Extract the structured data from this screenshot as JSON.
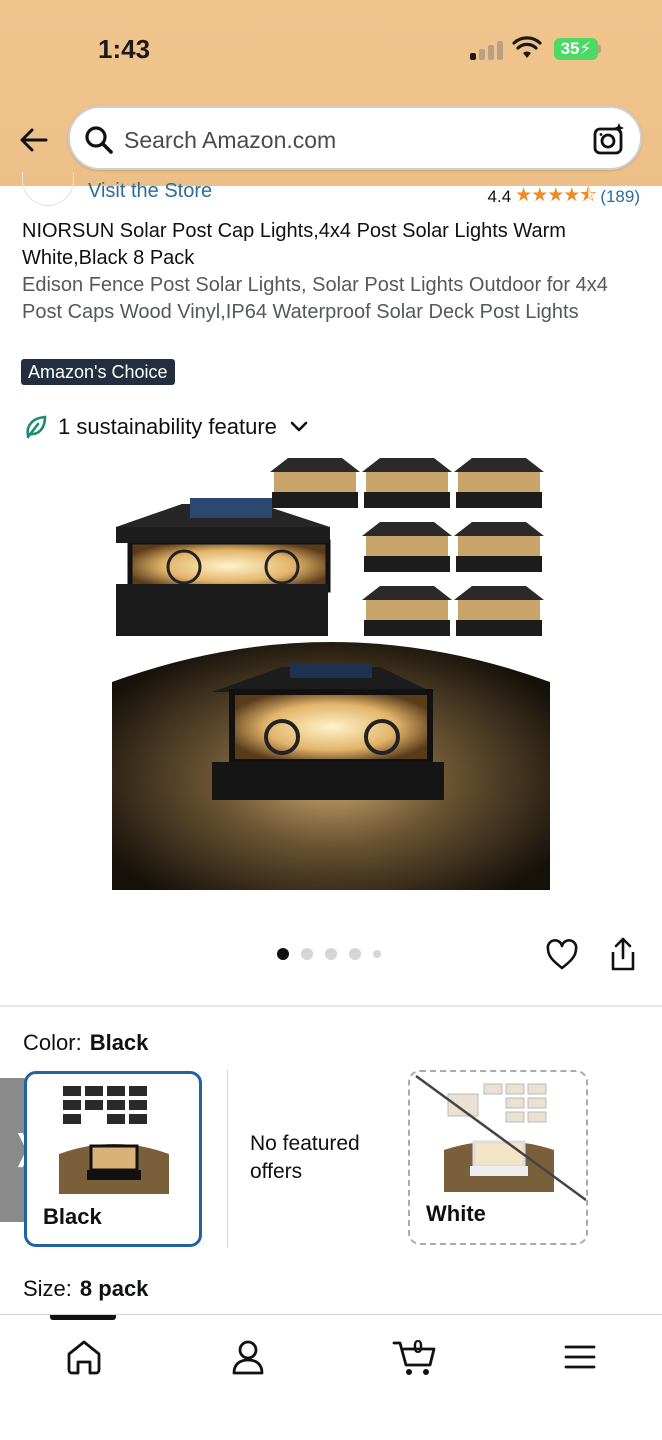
{
  "status_bar": {
    "time": "1:43",
    "battery": "35"
  },
  "search": {
    "placeholder": "Search Amazon.com"
  },
  "store": {
    "link": "Visit the Store",
    "rating": "4.4",
    "stars": "★★★★⯪",
    "review_count": "(189)"
  },
  "product": {
    "title": "NIORSUN Solar Post Cap Lights,4x4 Post Solar Lights Warm White,Black 8 Pack",
    "subtitle": "Edison Fence Post Solar Lights, Solar Post Lights Outdoor for 4x4 Post Caps Wood Vinyl,IP64 Waterproof Solar Deck Post Lights",
    "badge": "Amazon's Choice",
    "sustainability": "1 sustainability feature"
  },
  "gallery": {
    "image_count": 5,
    "active_index": 0
  },
  "variations": {
    "color_label": "Color:",
    "color_value": "Black",
    "swatches": [
      {
        "label": "Black"
      },
      {
        "label": "White"
      }
    ],
    "no_offers": "No featured offers",
    "size_label": "Size:",
    "size_value": "8 pack"
  },
  "bottom_nav": {
    "cart_count": "0"
  },
  "colors": {
    "header": "#efc28c",
    "accent_link": "#2b6d9a",
    "star": "#f08a24",
    "selected_border": "#2162a1",
    "badge_bg": "#232f3e"
  }
}
